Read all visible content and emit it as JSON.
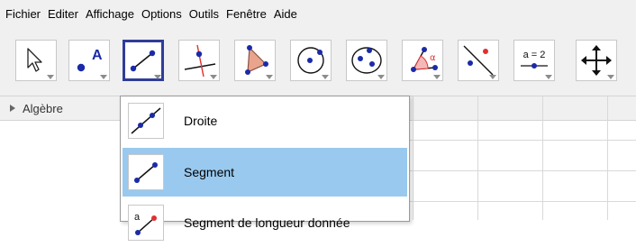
{
  "menu": [
    "Fichier",
    "Editer",
    "Affichage",
    "Options",
    "Outils",
    "Fenêtre",
    "Aide"
  ],
  "toolbar": {
    "tools": [
      {
        "icon": "move-pointer-icon"
      },
      {
        "icon": "new-point-icon",
        "label": "A"
      },
      {
        "icon": "segment-line-icon",
        "selected": true
      },
      {
        "icon": "perpendicular-line-icon"
      },
      {
        "icon": "polygon-icon"
      },
      {
        "icon": "circle-center-point-icon"
      },
      {
        "icon": "ellipse-icon"
      },
      {
        "icon": "angle-icon",
        "label": "α"
      },
      {
        "icon": "reflect-about-line-icon"
      },
      {
        "icon": "slider-icon",
        "label": "a = 2"
      },
      {
        "icon": "move-graphics-view-icon"
      }
    ]
  },
  "algebra": {
    "title": "Algèbre"
  },
  "dropdown": {
    "items": [
      {
        "label": "Droite",
        "icon": "line-through-two-points-icon",
        "highlighted": false
      },
      {
        "label": "Segment",
        "icon": "segment-icon",
        "highlighted": true
      },
      {
        "label": "Segment de longueur donnée",
        "icon": "segment-fixed-length-icon",
        "icon_label": "a",
        "highlighted": false
      }
    ]
  },
  "colors": {
    "accent": "#2f3d99",
    "highlight": "#99c9ee",
    "point": "#1a2aa8",
    "red": "#e03030"
  }
}
